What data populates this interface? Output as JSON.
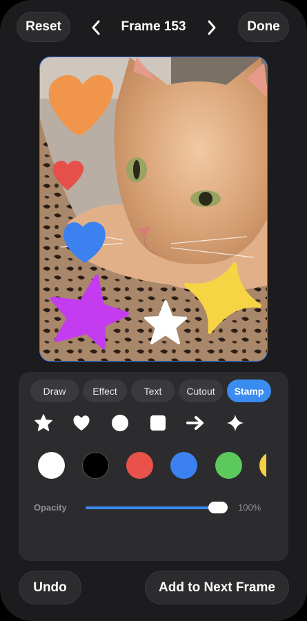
{
  "header": {
    "reset_label": "Reset",
    "title": "Frame 153",
    "done_label": "Done",
    "prev_icon": "chevron-left-icon",
    "next_icon": "chevron-right-icon"
  },
  "canvas": {
    "photo": "cat on leopard-print blanket",
    "stamps": [
      {
        "shape": "heart",
        "color": "#f0954a"
      },
      {
        "shape": "heart",
        "color": "#e6504a"
      },
      {
        "shape": "heart",
        "color": "#3b82f0"
      },
      {
        "shape": "star",
        "color": "#c43cf0"
      },
      {
        "shape": "star",
        "color": "#ffffff"
      },
      {
        "shape": "sparkle",
        "color": "#f7d443"
      }
    ]
  },
  "editor": {
    "tabs": [
      {
        "label": "Draw",
        "active": false
      },
      {
        "label": "Effect",
        "active": false
      },
      {
        "label": "Text",
        "active": false
      },
      {
        "label": "Cutout",
        "active": false
      },
      {
        "label": "Stamp",
        "active": true
      }
    ],
    "shapes": [
      "star-icon",
      "heart-icon",
      "circle-icon",
      "square-icon",
      "arrow-right-icon",
      "sparkle-icon",
      "more-icon"
    ],
    "colors": [
      "#ffffff",
      "#000000",
      "#e8524a",
      "#3b82f0",
      "#5cc95c",
      "#f5d046"
    ],
    "opacity": {
      "label": "Opacity",
      "value_text": "100%",
      "value": 1.0
    }
  },
  "footer": {
    "undo_label": "Undo",
    "add_label": "Add to Next Frame"
  },
  "theme": {
    "accent": "#3b8cf0",
    "background": "#1c1c1e",
    "surface": "#2c2c2e"
  }
}
